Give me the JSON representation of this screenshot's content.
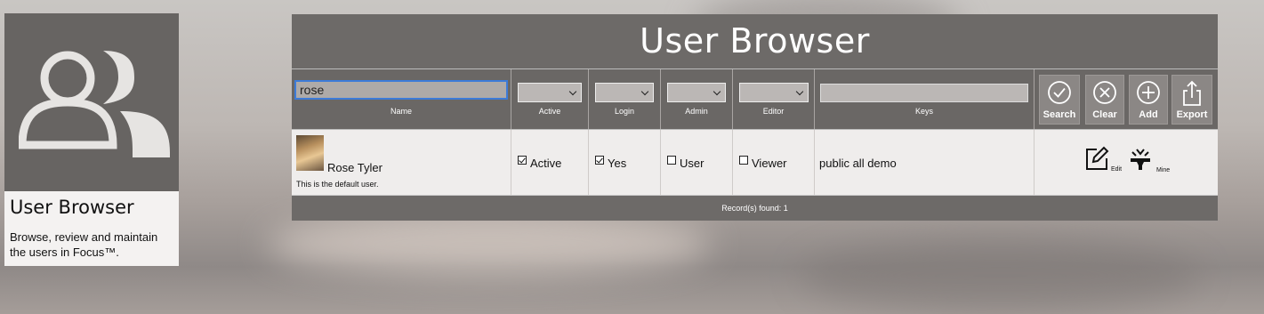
{
  "card": {
    "title": "User Browser",
    "description": "Browse, review and maintain the users in Focus™."
  },
  "browser": {
    "title": "User Browser",
    "filters": {
      "name": {
        "value": "rose",
        "label": "Name"
      },
      "active": {
        "label": "Active"
      },
      "login": {
        "label": "Login"
      },
      "admin": {
        "label": "Admin"
      },
      "editor": {
        "label": "Editor"
      },
      "keys": {
        "value": "",
        "label": "Keys"
      }
    },
    "buttons": {
      "search": "Search",
      "clear": "Clear",
      "add": "Add",
      "export": "Export"
    },
    "rows": [
      {
        "name": "Rose Tyler",
        "note": "This is the default user.",
        "active": "Active",
        "login": "Yes",
        "admin": "User",
        "editor": "Viewer",
        "keys": "public all demo",
        "edit_label": "Edit",
        "mine_label": "Mine"
      }
    ],
    "footer": "Record(s) found: 1"
  },
  "icons": [
    "users-icon",
    "search-icon",
    "clear-icon",
    "add-icon",
    "export-icon",
    "edit-icon",
    "mine-icon"
  ]
}
